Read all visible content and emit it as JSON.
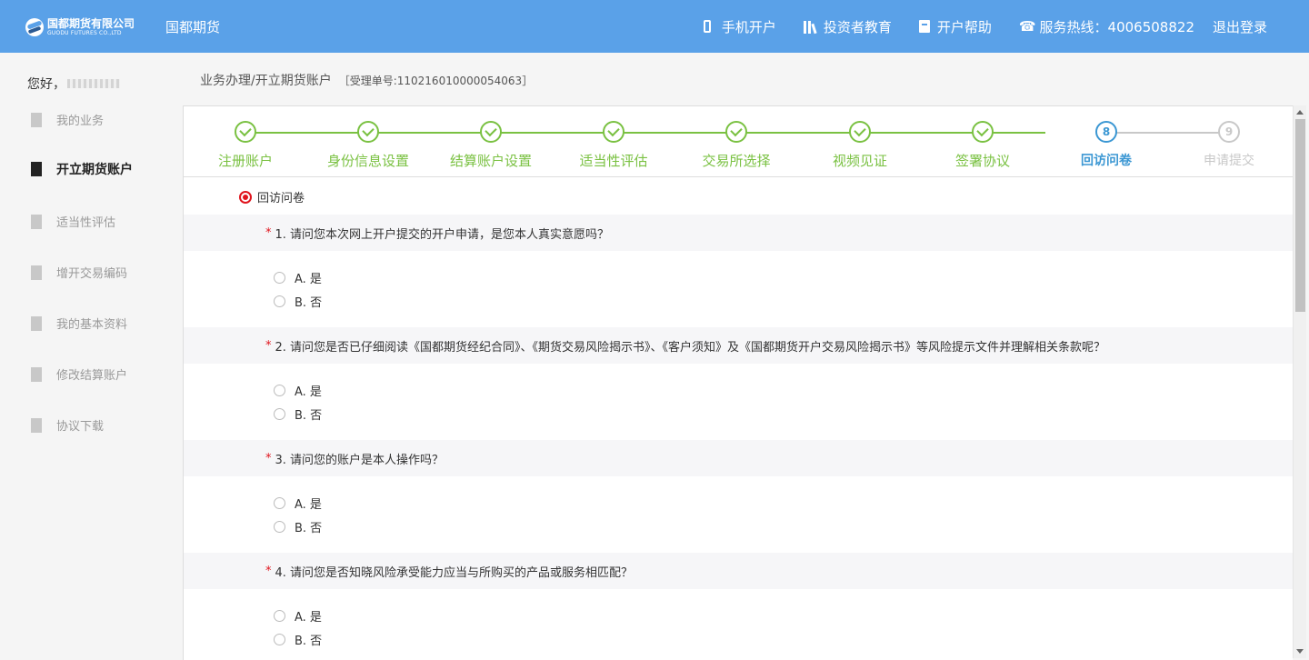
{
  "header": {
    "logo_cn": "国都期货有限公司",
    "logo_en": "GUODU FUTURES CO.,LTD",
    "brand": "国都期货",
    "nav": {
      "mobile_open": "手机开户",
      "investor_edu": "投资者教育",
      "open_help": "开户帮助",
      "hotline": "服务热线：4006508822",
      "logout": "退出登录"
    }
  },
  "sidebar": {
    "greeting": "您好，",
    "items": [
      {
        "label": "我的业务"
      },
      {
        "label": "开立期货账户"
      },
      {
        "label": "适当性评估"
      },
      {
        "label": "增开交易编码"
      },
      {
        "label": "我的基本资料"
      },
      {
        "label": "修改结算账户"
      },
      {
        "label": "协议下载"
      }
    ]
  },
  "breadcrumb": {
    "path": "业务办理/开立期货账户",
    "ticket": "［受理单号:110216010000054063］"
  },
  "steps": [
    {
      "label": "注册账户",
      "state": "done"
    },
    {
      "label": "身份信息设置",
      "state": "done"
    },
    {
      "label": "结算账户设置",
      "state": "done"
    },
    {
      "label": "适当性评估",
      "state": "done"
    },
    {
      "label": "交易所选择",
      "state": "done"
    },
    {
      "label": "视频见证",
      "state": "done"
    },
    {
      "label": "签署协议",
      "state": "done"
    },
    {
      "label": "回访问卷",
      "state": "current",
      "num": "8"
    },
    {
      "label": "申请提交",
      "state": "todo",
      "num": "9"
    }
  ],
  "survey": {
    "title": "回访问卷",
    "questions": [
      {
        "star": "*",
        "text": "1. 请问您本次网上开户提交的开户申请，是您本人真实意愿吗？",
        "options": [
          "A. 是",
          "B. 否"
        ]
      },
      {
        "star": "*",
        "text": "2. 请问您是否已仔细阅读《国都期货经纪合同》、《期货交易风险揭示书》、《客户须知》及《国都期货开户交易风险揭示书》等风险提示文件并理解相关条款呢？",
        "options": [
          "A. 是",
          "B. 否"
        ]
      },
      {
        "star": "*",
        "text": "3. 请问您的账户是本人操作吗？",
        "options": [
          "A. 是",
          "B. 否"
        ]
      },
      {
        "star": "*",
        "text": "4. 请问您是否知晓风险承受能力应当与所购买的产品或服务相匹配？",
        "options": [
          "A. 是",
          "B. 否"
        ]
      }
    ]
  },
  "colors": {
    "header_bg": "#5aa1e8",
    "step_done": "#7ac142",
    "step_current": "#3b97d3",
    "step_todo": "#c8c8c8",
    "required_star": "#e0141d"
  }
}
